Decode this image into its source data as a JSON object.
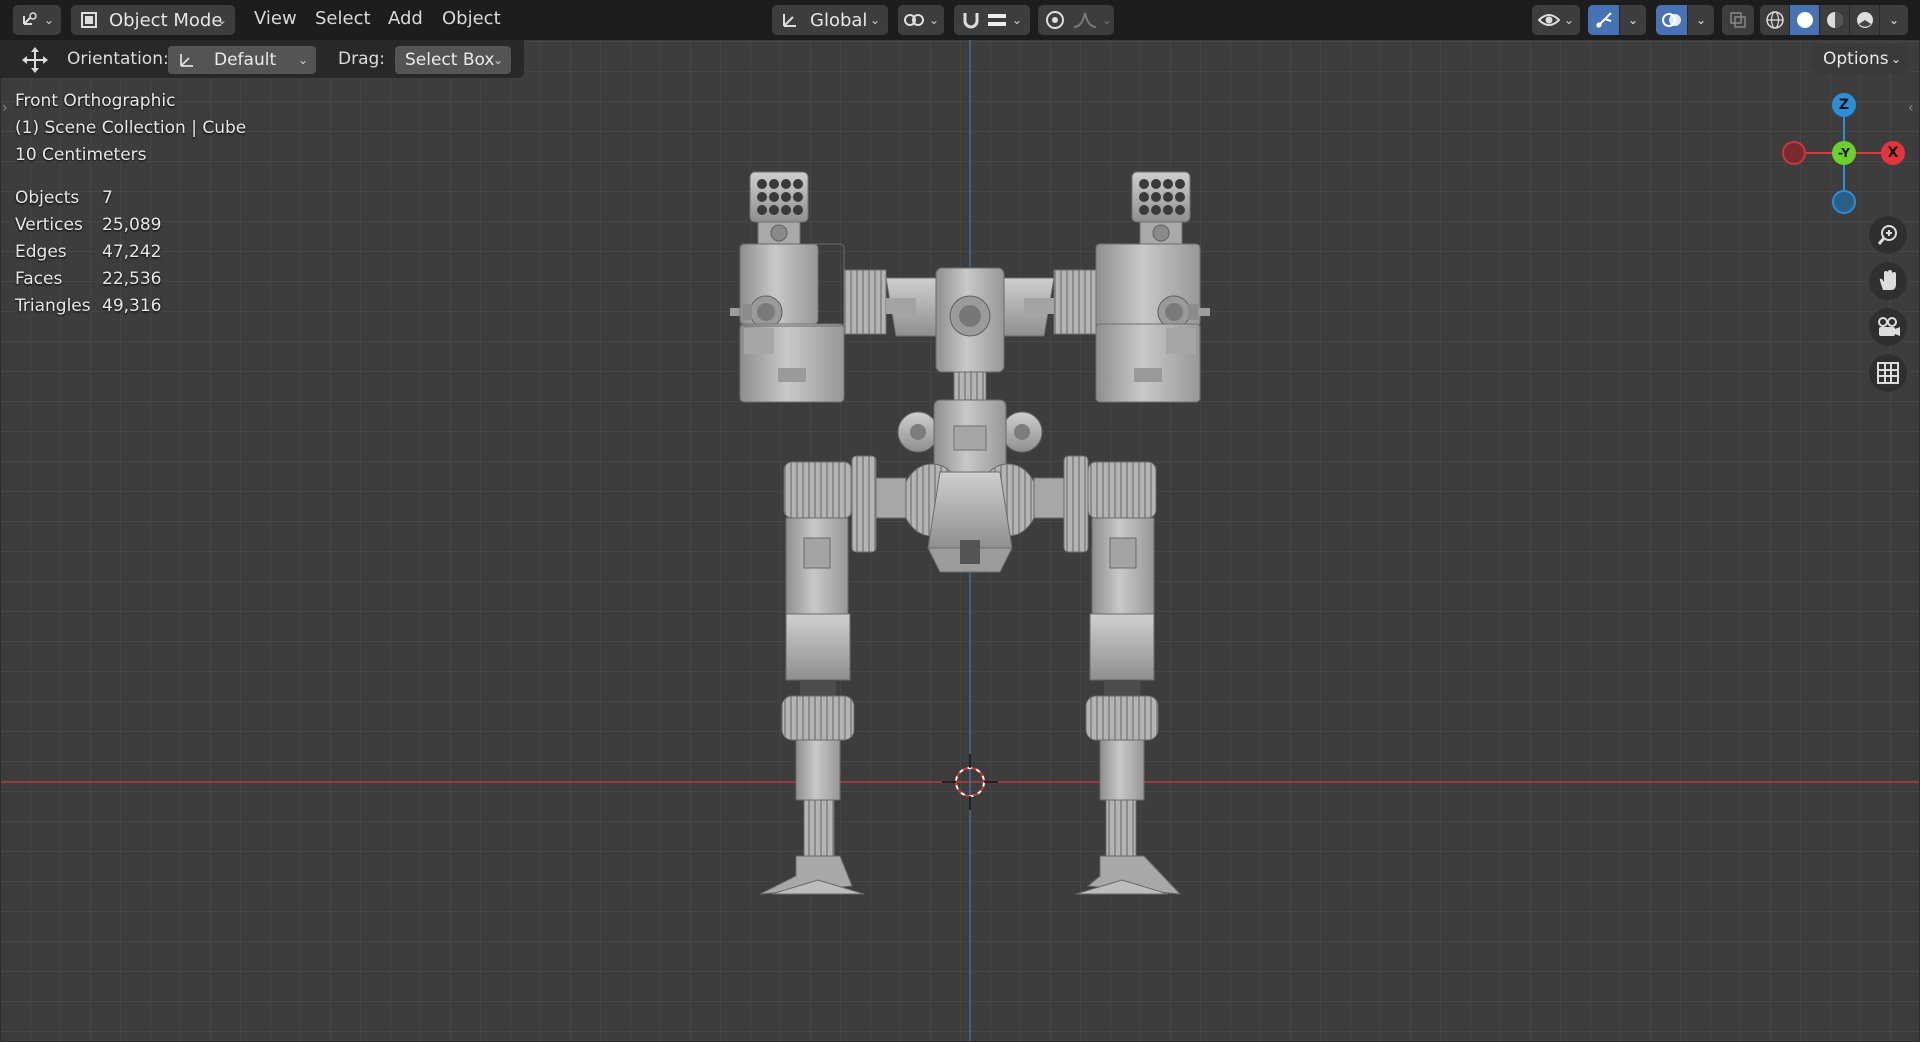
{
  "header": {
    "editor_type_icon": "3d-viewport-icon",
    "mode": {
      "label": "Object Mode",
      "icon": "object-mode-icon"
    },
    "menus": [
      "View",
      "Select",
      "Add",
      "Object"
    ],
    "transform_orientation": {
      "label": "Global",
      "icon": "orientation-icon"
    },
    "pivot_icon": "pivot-link-icon",
    "snap_icon": "magnet-icon",
    "snap_target_icon": "snap-increment-icon",
    "proportional_icon": "proportional-edit-icon",
    "falloff_icon": "falloff-curve-icon",
    "visibility_icon": "eye-icon",
    "gizmo_icon": "gizmo-icon",
    "overlay_icon": "overlay-icon",
    "xray_icon": "xray-icon",
    "shading_modes": [
      "wireframe-icon",
      "solid-icon",
      "material-icon",
      "rendered-icon"
    ],
    "active_shading": 1
  },
  "tool_settings": {
    "move_icon": "move-tool-icon",
    "orientation_label": "Orientation:",
    "orientation_value": "Default",
    "drag_label": "Drag:",
    "drag_value": "Select Box",
    "options_label": "Options"
  },
  "overlay": {
    "view_name": "Front Orthographic",
    "collection": "(1) Scene Collection | Cube",
    "grid_scale": "10 Centimeters",
    "stats": [
      {
        "label": "Objects",
        "value": "7"
      },
      {
        "label": "Vertices",
        "value": "25,089"
      },
      {
        "label": "Edges",
        "value": "47,242"
      },
      {
        "label": "Faces",
        "value": "22,536"
      },
      {
        "label": "Triangles",
        "value": "49,316"
      }
    ]
  },
  "gizmo": {
    "z_label": "Z",
    "y_label": "-Y",
    "x_label": "X",
    "colors": {
      "x": "#e3333d",
      "y": "#6ad12a",
      "z": "#2a8ed9",
      "neg_x": "#7a2a2e",
      "neg_z": "#2a5f88"
    }
  },
  "nav_buttons": [
    "zoom-icon",
    "hand-pan-icon",
    "camera-view-icon",
    "grid-ortho-icon"
  ],
  "colors": {
    "accent": "#4772b3",
    "viewport_bg": "#3d3d3d",
    "header_bg": "#1d1d1d",
    "x_axis": "#9a3a40",
    "z_axis": "#3f6f97",
    "model": "#b8b8b8"
  }
}
